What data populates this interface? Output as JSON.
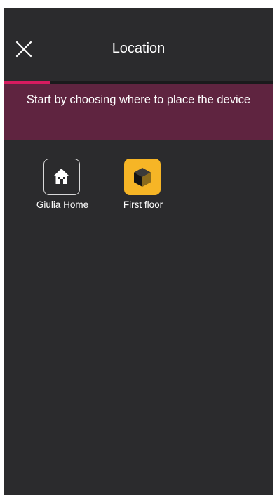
{
  "header": {
    "title": "Location",
    "close_icon": "close-icon"
  },
  "progress": {
    "fraction": 0.17,
    "fill_color": "#d81b60"
  },
  "banner": {
    "text": "Start by choosing where to place the device",
    "background": "#5f2440"
  },
  "locations": [
    {
      "label": "Giulia Home",
      "icon": "home-icon"
    },
    {
      "label": "First floor",
      "icon": "cube-icon",
      "accent": "#f6b526"
    }
  ]
}
